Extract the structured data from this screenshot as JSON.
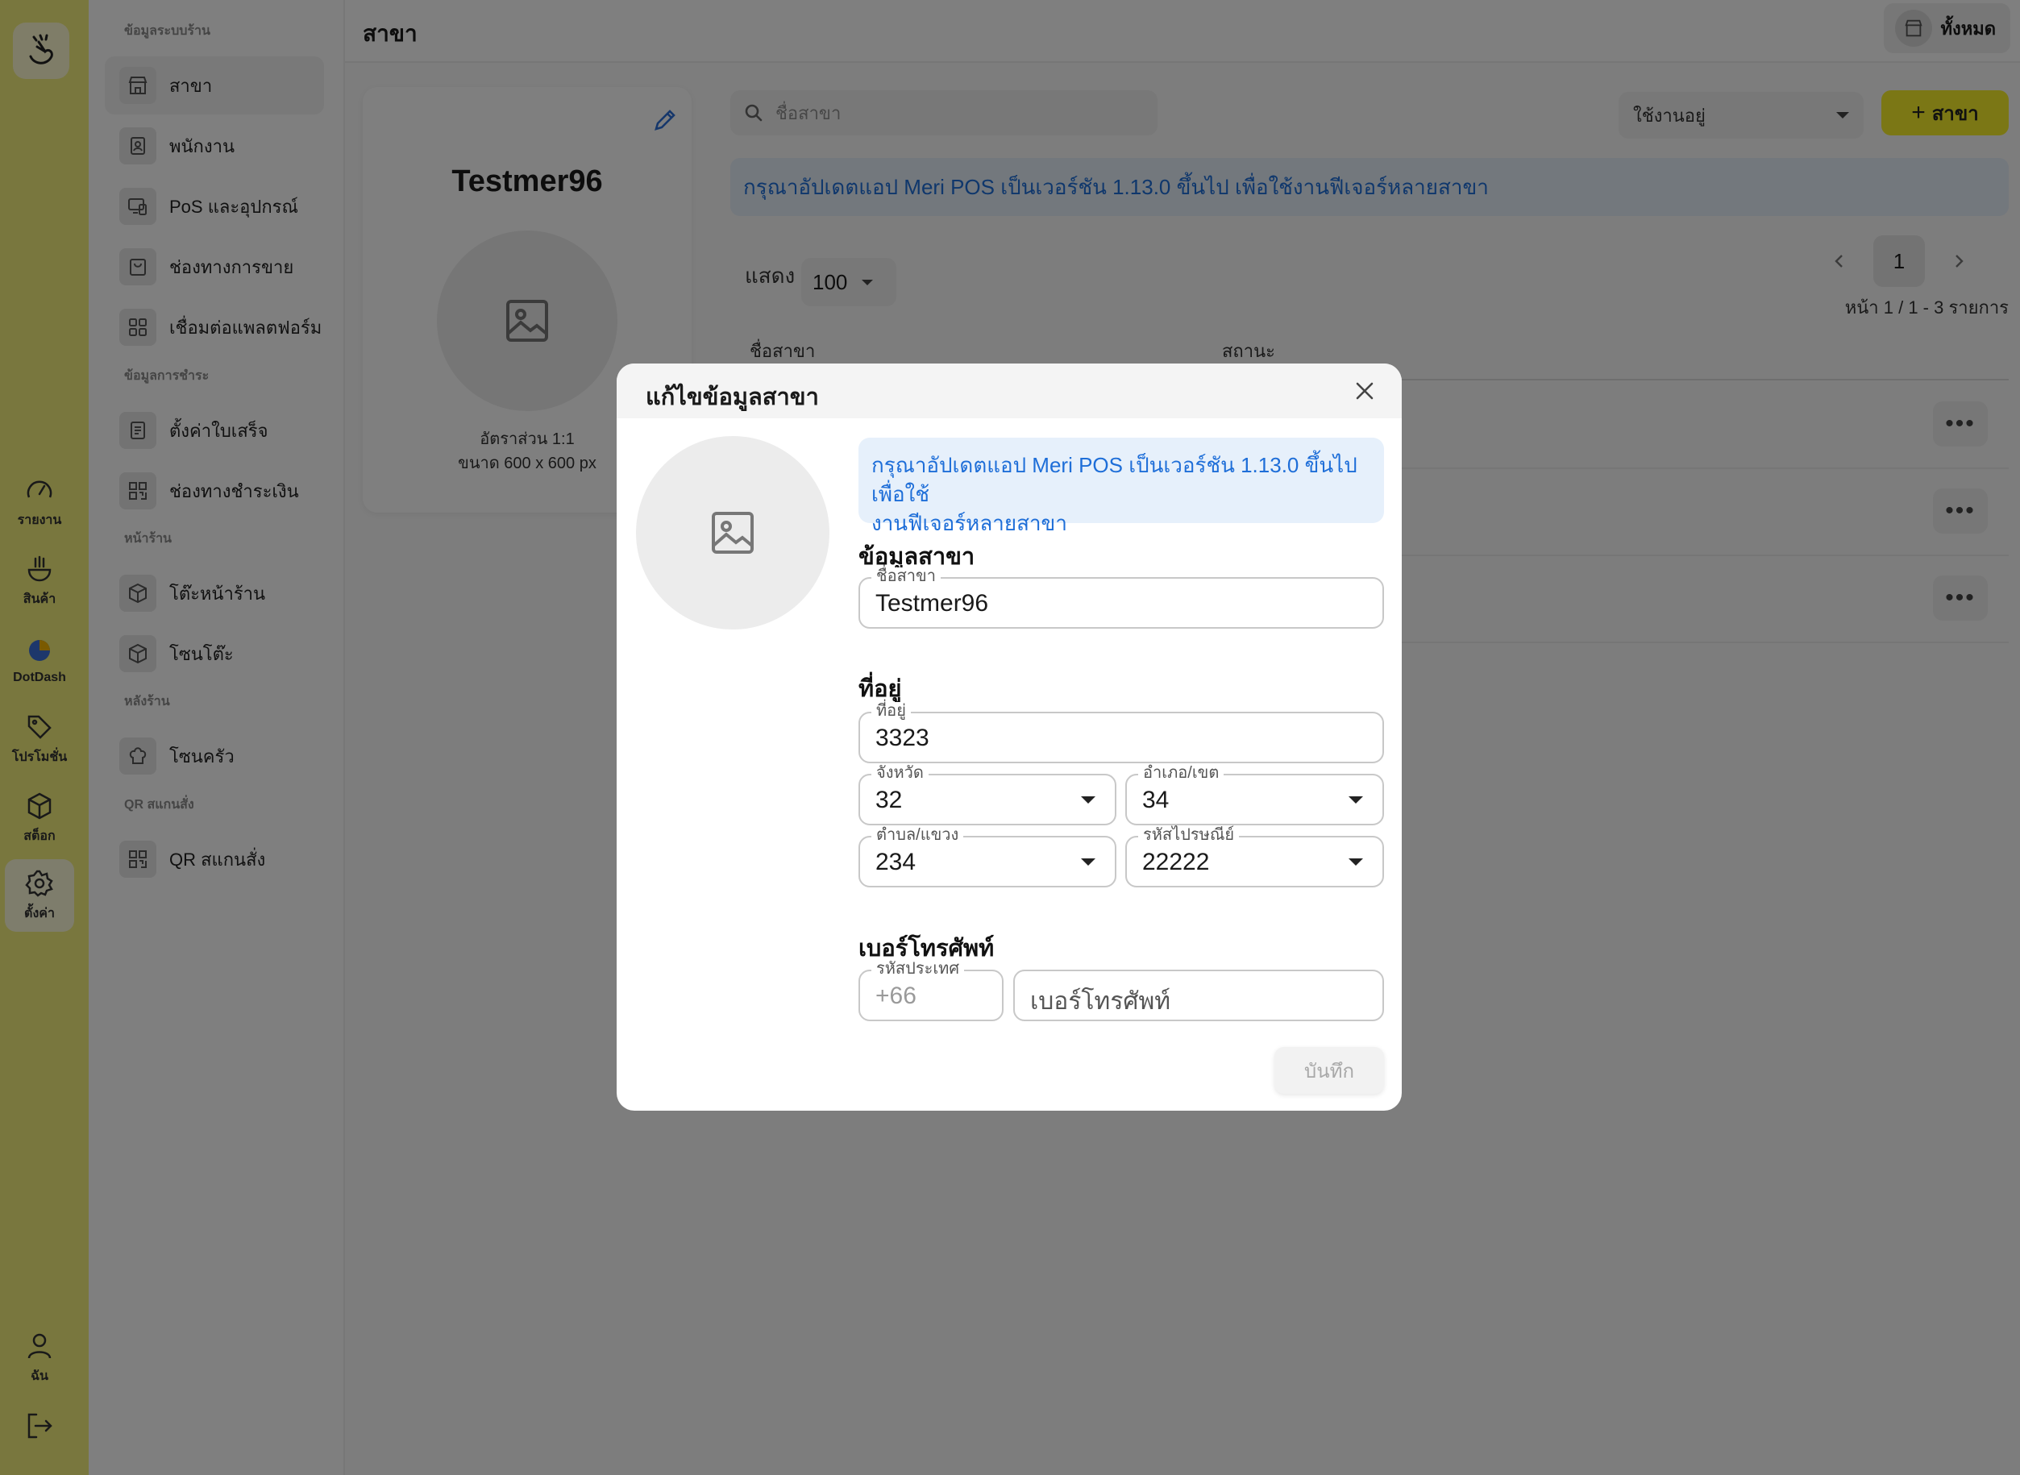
{
  "nav_rail": {
    "items": [
      {
        "label": "รายงาน",
        "icon": "speedometer-icon"
      },
      {
        "label": "สินค้า",
        "icon": "bowl-icon"
      },
      {
        "label": "DotDash",
        "icon": "dotdash-icon"
      },
      {
        "label": "โปรโมชั่น",
        "icon": "tag-icon"
      },
      {
        "label": "สต็อก",
        "icon": "box-icon"
      },
      {
        "label": "ตั้งค่า",
        "icon": "gear-icon",
        "active": true
      }
    ],
    "user_label": "ฉัน"
  },
  "side_menu": {
    "sections": [
      {
        "title": "ข้อมูลระบบร้าน",
        "items": [
          "สาขา",
          "พนักงาน",
          "PoS และอุปกรณ์",
          "ช่องทางการขาย",
          "เชื่อมต่อแพลตฟอร์ม"
        ]
      },
      {
        "title": "ข้อมูลการชำระ",
        "items": [
          "ตั้งค่าใบเสร็จ",
          "ช่องทางชำระเงิน"
        ]
      },
      {
        "title": "หน้าร้าน",
        "items": [
          "โต๊ะหน้าร้าน",
          "โซนโต๊ะ"
        ]
      },
      {
        "title": "หลังร้าน",
        "items": [
          "โซนครัว"
        ]
      },
      {
        "title": "QR สแกนสั่ง",
        "items": [
          "QR สแกนสั่ง"
        ]
      }
    ],
    "active": "สาขา"
  },
  "header": {
    "title": "สาขา",
    "all_button": "ทั้งหมด"
  },
  "branch_card": {
    "name": "Testmer96",
    "ratio": "อัตราส่วน 1:1",
    "size": "ขนาด 600 x 600 px"
  },
  "toolbar": {
    "search_placeholder": "ชื่อสาขา",
    "status_value": "ใช้งานอยู่",
    "add_label": "สาขา"
  },
  "banner": "กรุณาอัปเดตแอป Meri POS เป็นเวอร์ชัน 1.13.0 ขึ้นไป เพื่อใช้งานฟีเจอร์หลายสาขา",
  "list": {
    "show_label": "แสดง",
    "per_page": "100",
    "page": "1",
    "page_info": "หน้า 1 / 1 - 3 รายการ",
    "columns": [
      "ชื่อสาขา",
      "สถานะ"
    ],
    "rows": 3
  },
  "modal": {
    "title": "แก้ไขข้อมูลสาขา",
    "banner_line1": "กรุณาอัปเดตแอป Meri POS เป็นเวอร์ชัน 1.13.0 ขึ้นไป เพื่อใช้",
    "banner_line2": "งานฟีเจอร์หลายสาขา",
    "info_section": "ข้อมูลสาขา",
    "name_label": "ชื่อสาขา",
    "name_value": "Testmer96",
    "address_section": "ที่อยู่",
    "address_label": "ที่อยู่",
    "address_value": "3323",
    "province_label": "จังหวัด",
    "province_value": "32",
    "district_label": "อำเภอ/เขต",
    "district_value": "34",
    "subdistrict_label": "ตำบล/แขวง",
    "subdistrict_value": "234",
    "postal_label": "รหัสไปรษณีย์",
    "postal_value": "22222",
    "phone_section": "เบอร์โทรศัพท์",
    "country_label": "รหัสประเทศ",
    "country_value": "+66",
    "phone_placeholder": "เบอร์โทรศัพท์",
    "save_label": "บันทึก"
  },
  "colors": {
    "accent": "#f7ef2a",
    "rail": "#f2ee7c",
    "info_bg": "#e6f0fb",
    "info_text": "#1e6ed8"
  }
}
